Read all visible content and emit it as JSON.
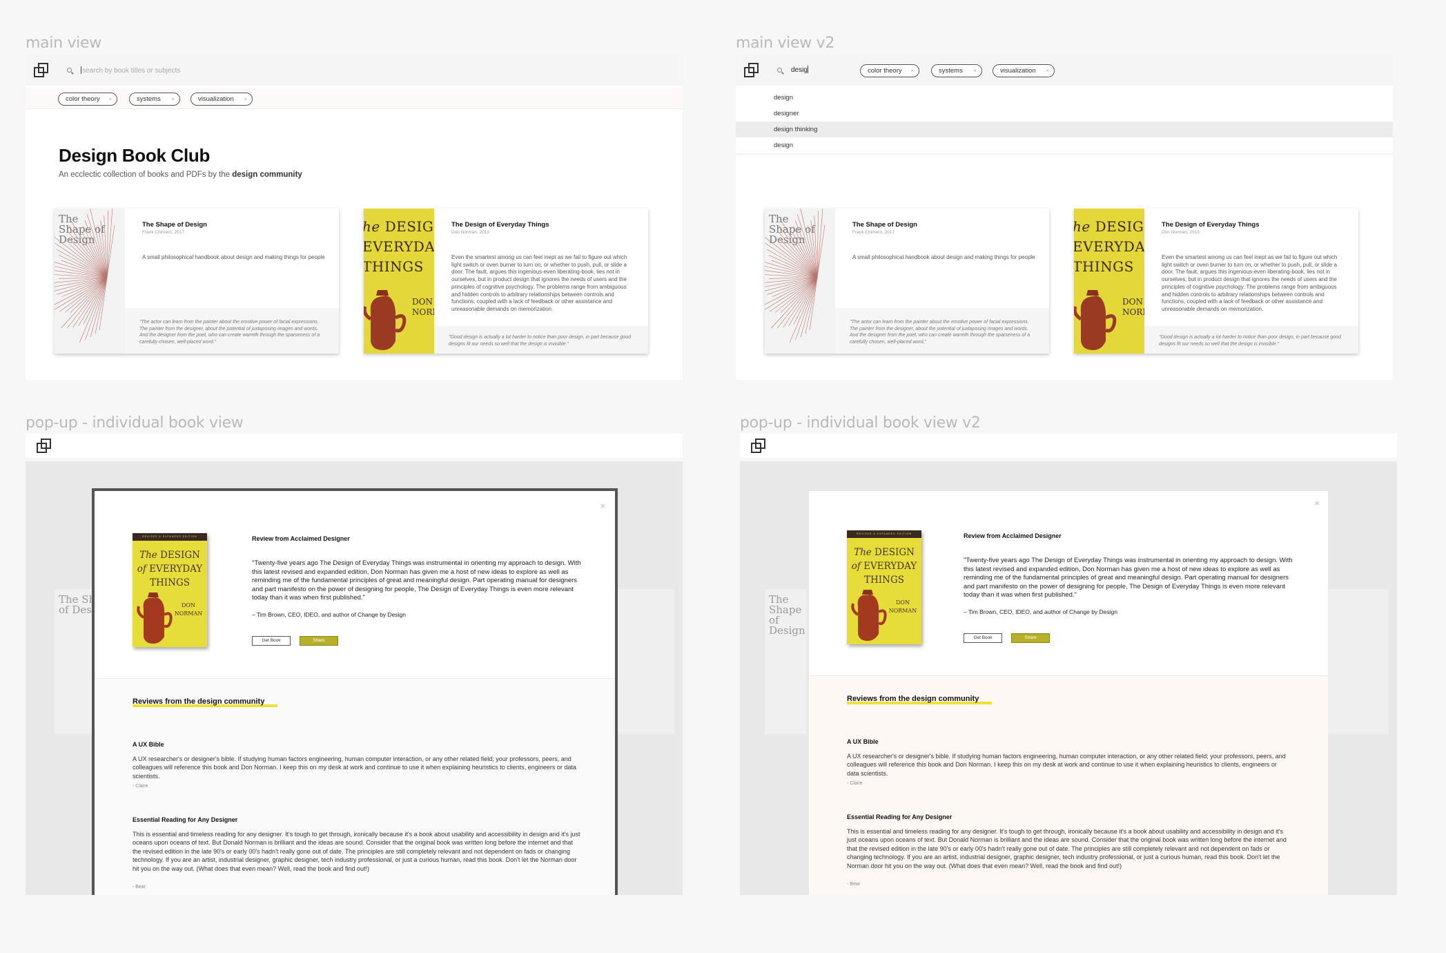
{
  "labels": {
    "main": "main view",
    "main_v2": "main view v2",
    "popup": "pop-up - individual book view",
    "popup_v2": "pop-up - individual book view v2"
  },
  "search": {
    "placeholder": "search by book titles or subjects",
    "typed": "desig"
  },
  "chips": [
    {
      "label": "color theory",
      "close": "×"
    },
    {
      "label": "systems",
      "close": "×"
    },
    {
      "label": "visualization",
      "close": "×"
    }
  ],
  "suggestions": [
    "design",
    "designer",
    "design thinking",
    "design"
  ],
  "page": {
    "title": "Design Book Club",
    "subtitle_prefix": "An ecclectic collection of books and PDFs by the",
    "subtitle_bold": "design community"
  },
  "books": [
    {
      "cover_text": "The Shape of Design",
      "title": "The Shape of Design",
      "meta": "Frank Chimero, 2017",
      "description": "A small philosophical handbook about design and making things for people",
      "quote": "\"The actor can learn from the painter about the emotive power of facial expressions. The painter from the designer, about the potential of juxtaposing images and words. And the designer from the poet, who can create warmth through the sparseness of a carefully chosen, well-placed word.\""
    },
    {
      "cover_text": "he DESIGN EVERYDAY THINGS",
      "cover_author": "DON NORMA",
      "title": "The Design of Everyday Things",
      "meta": "Don Norman, 2013",
      "description": "Even the smartest among us can feel inept as we fail to figure out which light switch or oven burner to turn on, or whether to push, pull, or slide a door. The fault, argues this ingenious-even liberating-book, lies not in ourselves, but in product design that ignores the needs of users and the principles of cognitive psychology. The problems range from ambiguous and hidden controls to arbitrary relationships between controls and functions, coupled with a lack of feedback or other assistance and unreasonable demands on memorization.",
      "quote": "\"Good design is actually a lot harder to notice than poor design, in part because good designs fit our needs so well that the design is invisible.\""
    }
  ],
  "popup": {
    "close": "×",
    "cover_band": "REVISED & EXPANDED EDITION",
    "cover_title": "The DESIGN of EVERYDAY THINGS",
    "cover_author": "DON NORMAN",
    "review_heading": "Review from Acclaimed Designer",
    "review_text": "\"Twenty-five years ago The Design of Everyday Things was instrumental in orienting my approach to design. With this latest revised and expanded edition, Don Norman has given me a host of new ideas to explore as well as reminding me of the fundamental principles of great and meaningful design. Part operating manual for designers and part manifesto on the power of designing for people, The Design of Everyday Things is even more relevant today than it was when first published.\"",
    "review_attr": "– Tim Brown, CEO, IDEO, and author of Change by Design",
    "get_book": "Get Book",
    "share": "Share",
    "community_heading": "Reviews from the design community",
    "reviews": [
      {
        "title": "A UX Bible",
        "text": "A UX researcher's or designer's bible. If studying human factors engineering, human computer interaction, or any other related field; your professors, peers, and colleagues will reference this book and Don Norman. I keep this on my desk at work and continue to use it when explaining heuristics to clients, engineers or data scientists.",
        "by": "- Claire"
      },
      {
        "title": "Essential Reading for Any Designer",
        "text": "This is essential and timeless reading for any designer. It's tough to get through, ironically because it's a book about usability and accessibility in design and it's just oceans upon oceans of text. But Donald Norman is brilliant and the ideas are sound. Consider that the original book was written long before the internet and that the revised edition in the late 90's or early 00's hadn't really gone out of date. The principles are still completely relevant and not dependent on fads or changing technology. If you are an artist, industrial designer, graphic designer, tech industry professional, or just a curious human, read this book. Don't let the Norman door hit you on the way out. (What does that even mean? Well, read the book and find out!)",
        "by": "- Bear"
      }
    ]
  },
  "colors": {
    "accent_yellow": "#eee23a",
    "share_button": "#b7b12a",
    "cover_yellow": "#e4d73a"
  }
}
